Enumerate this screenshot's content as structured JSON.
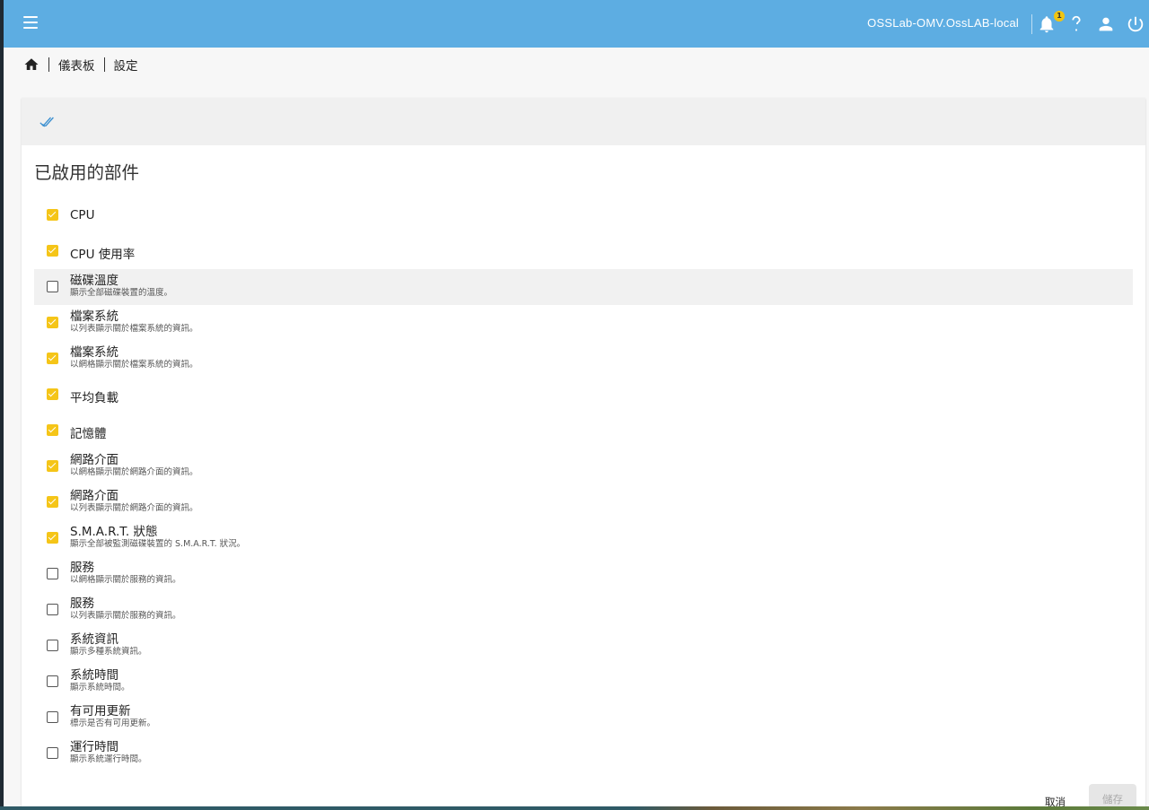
{
  "topbar": {
    "hostname": "OSSLab-OMV.OssLAB-local",
    "notification_count": "1",
    "bg_color": "#5dade2"
  },
  "breadcrumb": {
    "items": [
      "儀表板",
      "設定"
    ]
  },
  "card": {
    "title": "已啟用的部件",
    "widgets": [
      {
        "label": "CPU",
        "desc": "",
        "checked": true
      },
      {
        "label": "CPU 使用率",
        "desc": "",
        "checked": true
      },
      {
        "label": "磁碟溫度",
        "desc": "顯示全部磁碟裝置的溫度。",
        "checked": false
      },
      {
        "label": "檔案系統",
        "desc": "以列表顯示關於檔案系統的資訊。",
        "checked": true
      },
      {
        "label": "檔案系統",
        "desc": "以網格顯示關於檔案系統的資訊。",
        "checked": true
      },
      {
        "label": "平均負載",
        "desc": "",
        "checked": true
      },
      {
        "label": "記憶體",
        "desc": "",
        "checked": true
      },
      {
        "label": "網路介面",
        "desc": "以網格顯示關於網路介面的資訊。",
        "checked": true
      },
      {
        "label": "網路介面",
        "desc": "以列表顯示關於網路介面的資訊。",
        "checked": true
      },
      {
        "label": "S.M.A.R.T. 狀態",
        "desc": "顯示全部被監測磁碟裝置的 S.M.A.R.T. 狀況。",
        "checked": true
      },
      {
        "label": "服務",
        "desc": "以網格顯示關於服務的資訊。",
        "checked": false
      },
      {
        "label": "服務",
        "desc": "以列表顯示關於服務的資訊。",
        "checked": false
      },
      {
        "label": "系統資訊",
        "desc": "顯示多種系統資訊。",
        "checked": false
      },
      {
        "label": "系統時間",
        "desc": "顯示系統時間。",
        "checked": false
      },
      {
        "label": "有可用更新",
        "desc": "標示是否有可用更新。",
        "checked": false
      },
      {
        "label": "運行時間",
        "desc": "顯示系統運行時間。",
        "checked": false
      }
    ],
    "cancel_label": "取消",
    "save_label": "儲存"
  },
  "colors": {
    "accent": "#5dade2",
    "checkbox_checked": "#f5c518"
  }
}
